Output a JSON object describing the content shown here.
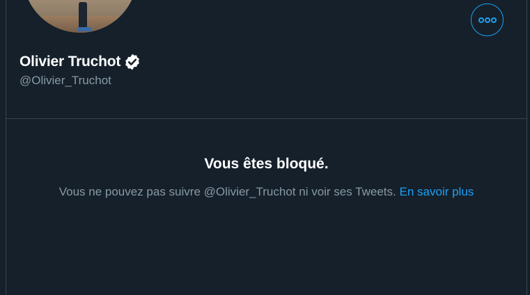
{
  "profile": {
    "display_name": "Olivier Truchot",
    "handle": "@Olivier_Truchot",
    "verified": true,
    "verified_icon": "verified-badge-icon",
    "more_icon": "more-options-icon"
  },
  "blocked": {
    "title": "Vous êtes bloqué.",
    "message": "Vous ne pouvez pas suivre @Olivier_Truchot ni voir ses Tweets.",
    "learn_more": "En savoir plus"
  },
  "colors": {
    "background": "#15202b",
    "accent": "#1da1f2",
    "secondary_text": "#8899a6",
    "border": "#38444d"
  }
}
